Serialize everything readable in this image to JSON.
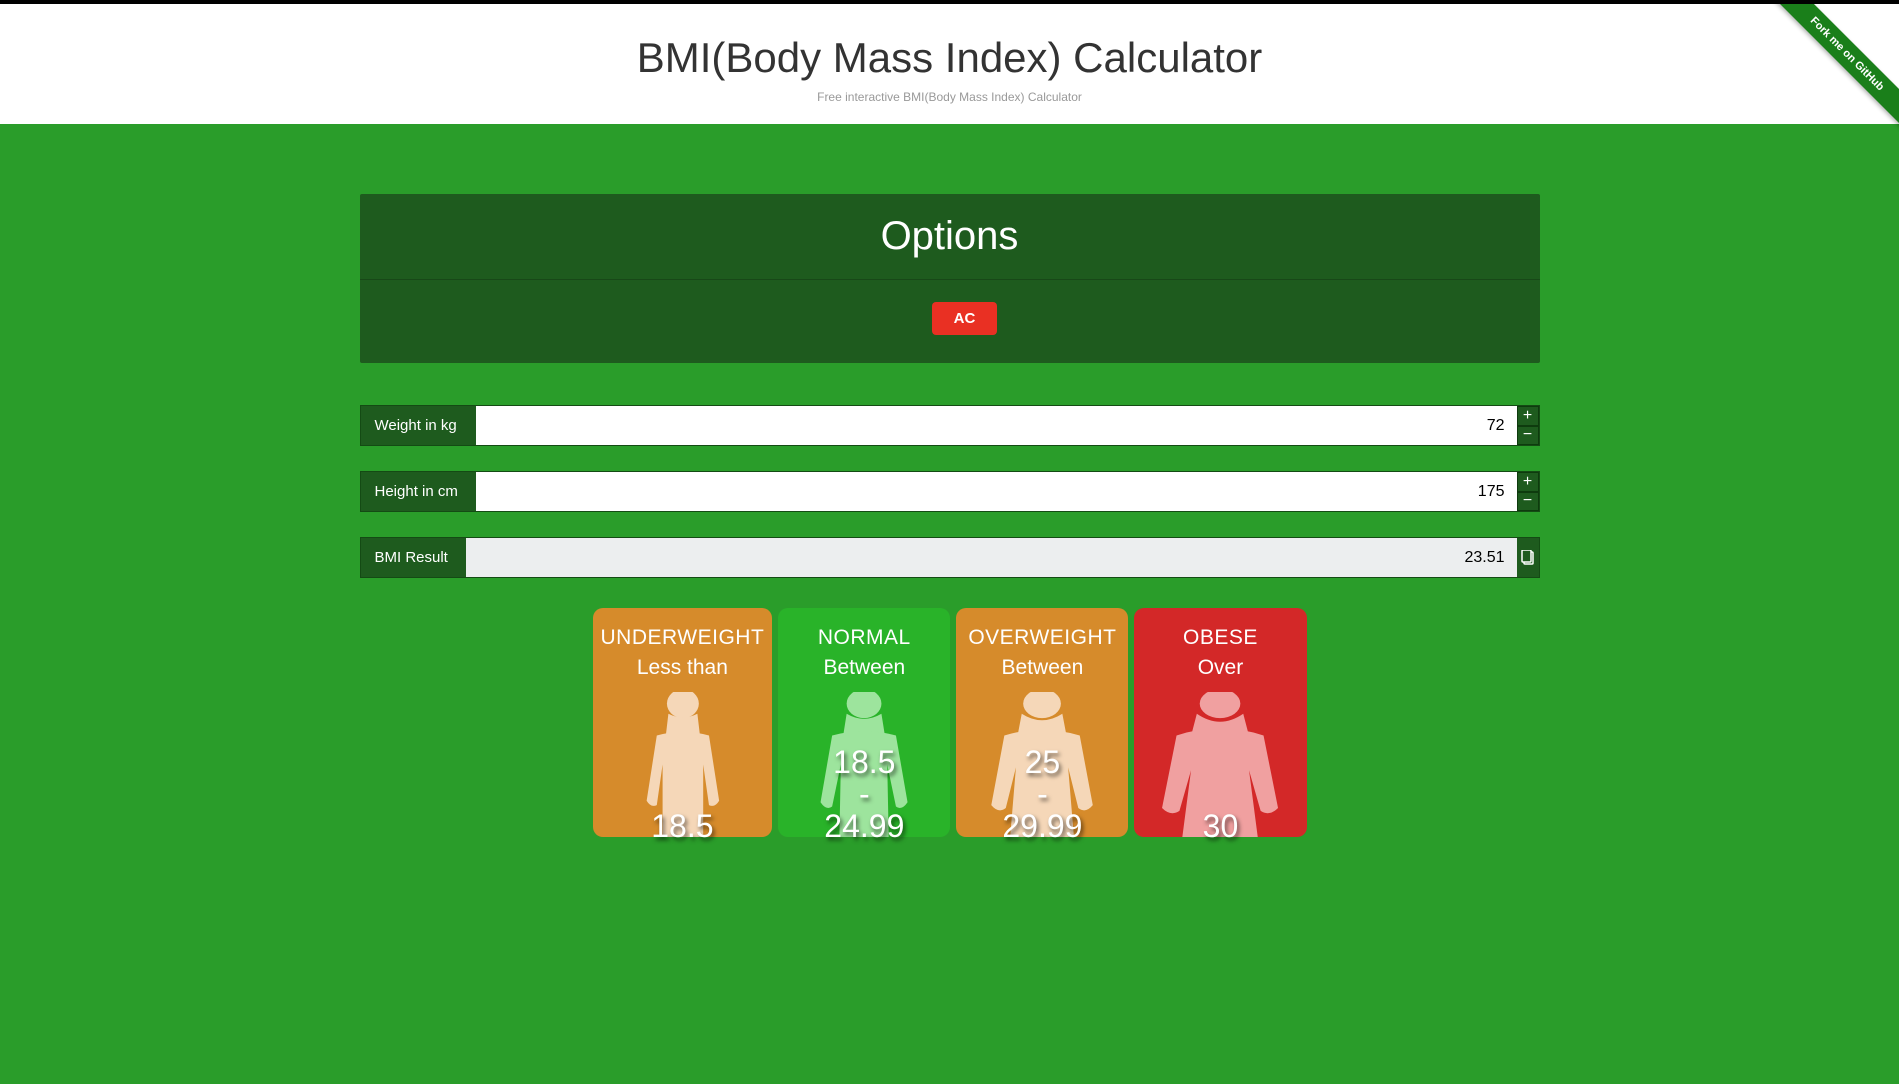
{
  "header": {
    "title": "BMI(Body Mass Index) Calculator",
    "subtitle": "Free interactive BMI(Body Mass Index) Calculator"
  },
  "ribbon": {
    "label": "Fork me on GitHub"
  },
  "options": {
    "title": "Options",
    "ac_label": "AC"
  },
  "inputs": {
    "weight": {
      "label": "Weight in kg",
      "value": "72"
    },
    "height": {
      "label": "Height in cm",
      "value": "175"
    },
    "result": {
      "label": "BMI Result",
      "value": "23.51"
    }
  },
  "categories": {
    "underweight": {
      "title": "UNDERWEIGHT",
      "sub": "Less than",
      "value": "18.5"
    },
    "normal": {
      "title": "NORMAL",
      "sub": "Between",
      "value": "18.5\n-\n24.99"
    },
    "overweight": {
      "title": "OVERWEIGHT",
      "sub": "Between",
      "value": "25\n-\n29.99"
    },
    "obese": {
      "title": "OBESE",
      "sub": "Over",
      "value": "30"
    }
  }
}
